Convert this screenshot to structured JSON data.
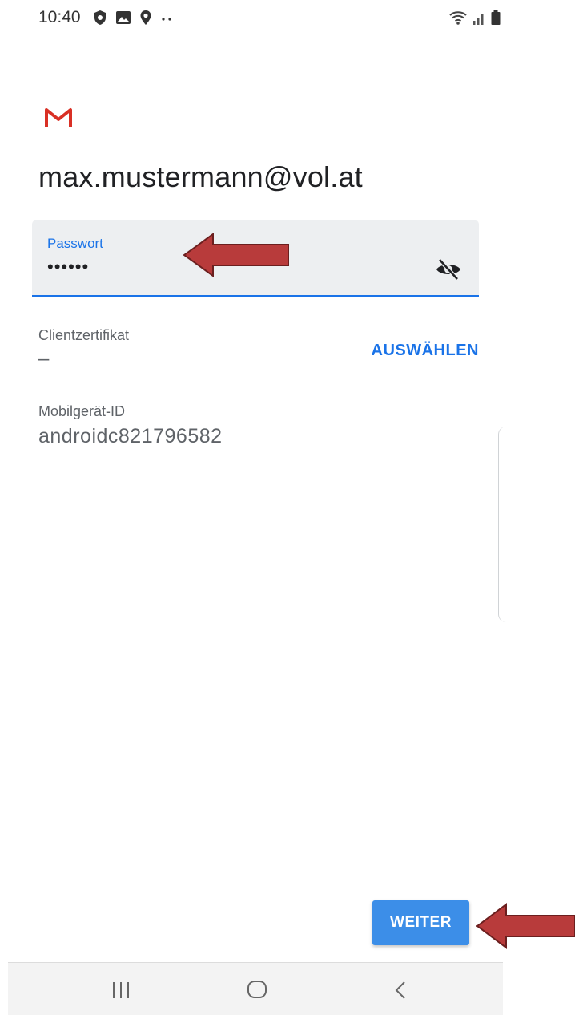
{
  "status_bar": {
    "time": "10:40",
    "left_icons": [
      "shield-icon",
      "image-icon",
      "location-icon",
      "more-dots-icon"
    ],
    "right_icons": [
      "wifi-icon",
      "signal-icon",
      "battery-icon"
    ]
  },
  "app": {
    "logo": "gmail-logo",
    "brand_color": "#d93025"
  },
  "account": {
    "email": "max.mustermann@vol.at"
  },
  "password": {
    "label": "Passwort",
    "value": "••••••",
    "toggle_icon": "visibility-off-icon"
  },
  "client_certificate": {
    "label": "Clientzertifikat",
    "value": "–",
    "button": "AUSWÄHLEN"
  },
  "device_id": {
    "label": "Mobilgerät-ID",
    "value": "androidc821796582"
  },
  "actions": {
    "next": "WEITER"
  },
  "nav_bar": {
    "icons": [
      "recents-icon",
      "home-icon",
      "back-icon"
    ]
  },
  "colors": {
    "accent": "#1a73e8",
    "button": "#3c8ee8",
    "arrow": "#b83b3b"
  }
}
